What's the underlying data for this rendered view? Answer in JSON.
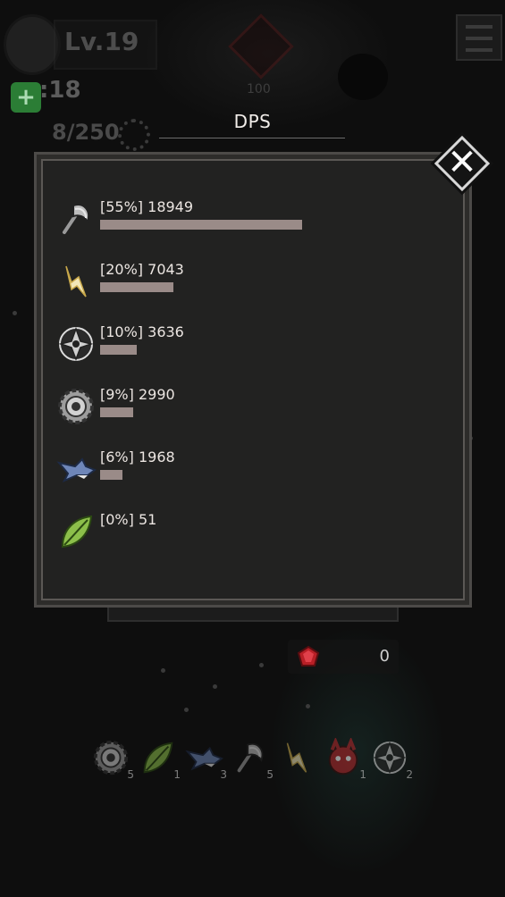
{
  "hud": {
    "level": "Lv.19",
    "timer": ":18",
    "kills": "8/250",
    "boss_count": "100"
  },
  "dialog": {
    "title": "DPS",
    "close_label": "✕"
  },
  "dps_entries": [
    {
      "icon": "axe-icon",
      "label": "[55%] 18949",
      "percent": 55
    },
    {
      "icon": "lightning-icon",
      "label": "[20%] 7043",
      "percent": 20
    },
    {
      "icon": "shuriken-icon",
      "label": "[10%] 3636",
      "percent": 10
    },
    {
      "icon": "sawblade-icon",
      "label": "[9%] 2990",
      "percent": 9
    },
    {
      "icon": "shark-icon",
      "label": "[6%] 1968",
      "percent": 6
    },
    {
      "icon": "leaf-icon",
      "label": "[0%] 51",
      "percent": 0
    }
  ],
  "gems": {
    "value": "0",
    "color": "#c0252b"
  },
  "inventory": [
    {
      "icon": "sawblade-icon",
      "count": "5"
    },
    {
      "icon": "leaf-icon",
      "count": "1"
    },
    {
      "icon": "shark-icon",
      "count": "3"
    },
    {
      "icon": "axe-icon",
      "count": "5"
    },
    {
      "icon": "lightning-icon",
      "count": ""
    },
    {
      "icon": "red-monster-icon",
      "count": "1"
    },
    {
      "icon": "shuriken-icon",
      "count": "2"
    }
  ],
  "colors": {
    "bar": "#9a8b88",
    "panel": "#222221",
    "accent_green": "#2f8a3a"
  }
}
